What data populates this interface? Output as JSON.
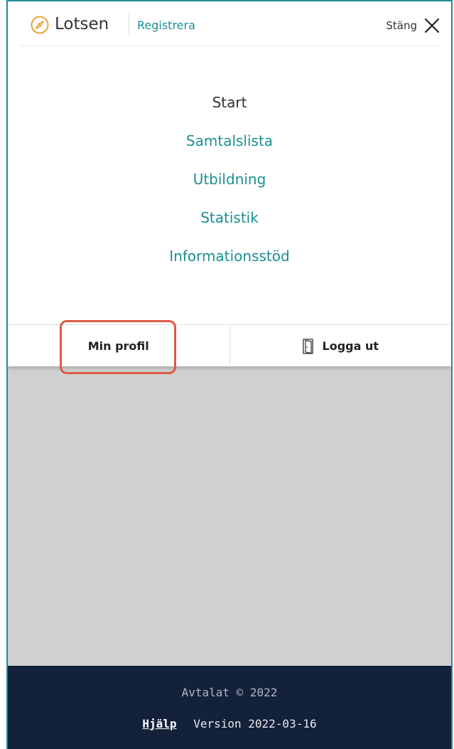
{
  "header": {
    "brand": "Lotsen",
    "register_label": "Registrera",
    "close_label": "Stäng",
    "logo_icon": "compass-icon",
    "close_icon": "close-icon"
  },
  "nav": {
    "items": [
      {
        "label": "Start",
        "active": true
      },
      {
        "label": "Samtalslista",
        "active": false
      },
      {
        "label": "Utbildning",
        "active": false
      },
      {
        "label": "Statistik",
        "active": false
      },
      {
        "label": "Informationsstöd",
        "active": false
      }
    ]
  },
  "bottom": {
    "profile_label": "Min profil",
    "logout_label": "Logga ut",
    "logout_icon": "door-icon"
  },
  "footer": {
    "copyright": "Avtalat © 2022",
    "help_label": "Hjälp",
    "version": "Version 2022-03-16"
  },
  "colors": {
    "accent": "#1a8f94",
    "footer_bg": "#13213a",
    "overlay": "#d0d0d0",
    "highlight": "#dd5a44",
    "logo": "#e8a33a"
  }
}
